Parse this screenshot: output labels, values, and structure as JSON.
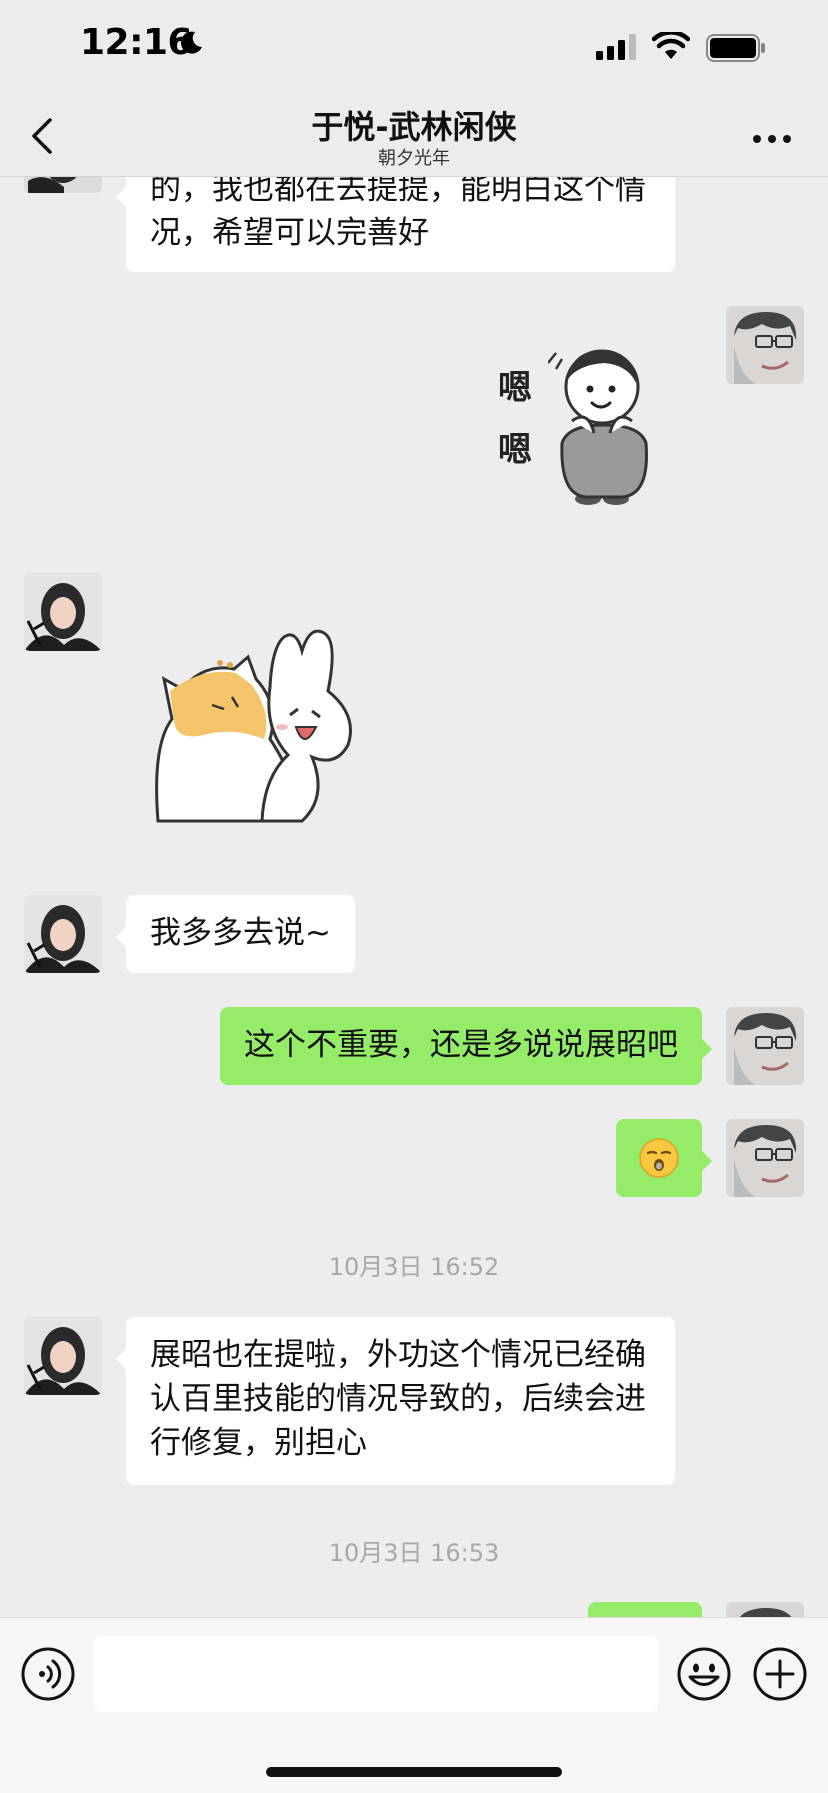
{
  "status_bar": {
    "time": "12:16"
  },
  "header": {
    "title": "于悦-武林闲侠",
    "subtitle": "朝夕光年"
  },
  "messages": {
    "m1_text": "的，我也都在去提提，能明白这个情况，希望可以完善好",
    "m2_sticker_text": "嗯嗯",
    "m4_text": "我多多去说~",
    "m5_text": "这个不重要，还是多说说展昭吧",
    "m6_emoji": "😮‍💨",
    "ts1": "10月3日 16:52",
    "m7_text": "展昭也在提啦，外功这个情况已经确认百里技能的情况导致的，后续会进行修复，别担心",
    "ts2": "10月3日 16:53"
  },
  "input_bar": {
    "value": "",
    "placeholder": ""
  },
  "colors": {
    "background": "#ededed",
    "outgoing_bubble": "#95ec69",
    "incoming_bubble": "#ffffff",
    "timestamp": "#a8a8a8"
  },
  "icons": {
    "back": "chevron-left-icon",
    "more": "more-dots-icon",
    "voice": "voice-icon",
    "emoji": "emoji-icon",
    "plus": "plus-icon"
  }
}
